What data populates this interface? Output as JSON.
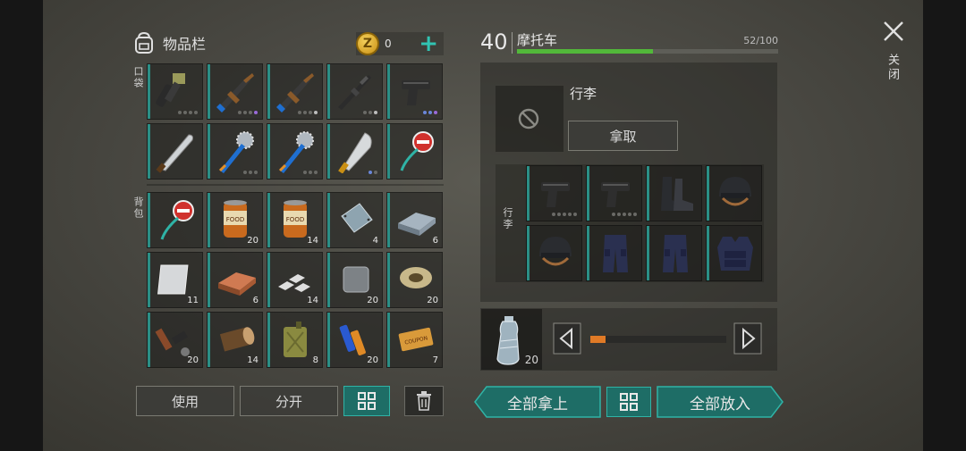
{
  "inventory": {
    "title": "物品栏",
    "coins": "0",
    "pocket_label": "口袋",
    "backpack_label": "背包",
    "pocket_slots": [
      {
        "item": "flamethrower",
        "qty": "",
        "dots": [
          "g",
          "g",
          "g",
          "g"
        ]
      },
      {
        "item": "assault-rifle",
        "qty": "",
        "dots": [
          "g",
          "g",
          "g",
          "p"
        ]
      },
      {
        "item": "assault-rifle",
        "qty": "",
        "dots": [
          "g",
          "g",
          "g",
          "w"
        ]
      },
      {
        "item": "rifle",
        "qty": "",
        "dots": [
          "g",
          "g",
          "w"
        ]
      },
      {
        "item": "pistol",
        "qty": "",
        "dots": [
          "b",
          "b",
          "p"
        ]
      },
      {
        "item": "machete",
        "qty": "",
        "dots": []
      },
      {
        "item": "saw-mace",
        "qty": "",
        "dots": [
          "g",
          "g",
          "g"
        ]
      },
      {
        "item": "saw-mace",
        "qty": "",
        "dots": [
          "g",
          "g",
          "g"
        ]
      },
      {
        "item": "cleaver",
        "qty": "",
        "dots": [
          "b",
          "g"
        ]
      },
      {
        "item": "stop-sign",
        "qty": "",
        "dots": []
      }
    ],
    "backpack_slots": [
      {
        "item": "stop-sign",
        "qty": ""
      },
      {
        "item": "food-can",
        "qty": "20"
      },
      {
        "item": "food-can",
        "qty": "14"
      },
      {
        "item": "metal-plate",
        "qty": "4"
      },
      {
        "item": "steel-ingot",
        "qty": "6"
      },
      {
        "item": "aluminum-sheet",
        "qty": "11"
      },
      {
        "item": "copper-ingot",
        "qty": "6"
      },
      {
        "item": "iron-bars",
        "qty": "14"
      },
      {
        "item": "iron-plate",
        "qty": "20"
      },
      {
        "item": "wire-spool",
        "qty": "20"
      },
      {
        "item": "weapon-parts",
        "qty": "20"
      },
      {
        "item": "wood-log",
        "qty": "14"
      },
      {
        "item": "fuel-canister",
        "qty": "8"
      },
      {
        "item": "batteries",
        "qty": "20"
      },
      {
        "item": "coupon",
        "qty": "7"
      }
    ],
    "buttons": {
      "use": "使用",
      "split": "分开"
    }
  },
  "vehicle": {
    "level": "40",
    "name": "摩托车",
    "capacity": "52/100",
    "capacity_fraction": 0.52,
    "luggage_title": "行李",
    "take_button": "拿取",
    "luggage_label": "行李",
    "luggage_slots": [
      {
        "item": "pistol",
        "dots": [
          "g",
          "g",
          "g",
          "g",
          "g"
        ]
      },
      {
        "item": "pistol",
        "dots": [
          "g",
          "g",
          "g",
          "g",
          "g"
        ]
      },
      {
        "item": "boots",
        "dots": []
      },
      {
        "item": "helmet",
        "dots": []
      },
      {
        "item": "helmet",
        "dots": []
      },
      {
        "item": "tactical-pants",
        "dots": []
      },
      {
        "item": "tactical-pants",
        "dots": []
      },
      {
        "item": "tactical-vest",
        "dots": []
      }
    ],
    "transfer_item": {
      "item": "water-bottle",
      "qty": "20",
      "slider_fraction": 0.0
    }
  },
  "actions": {
    "take_all": "全部拿上",
    "put_all": "全部放入"
  },
  "close_label": "关闭",
  "colors": {
    "accent": "#2fb3a6",
    "capacity_fill": "#52b83a",
    "slider": "#e07a26"
  }
}
